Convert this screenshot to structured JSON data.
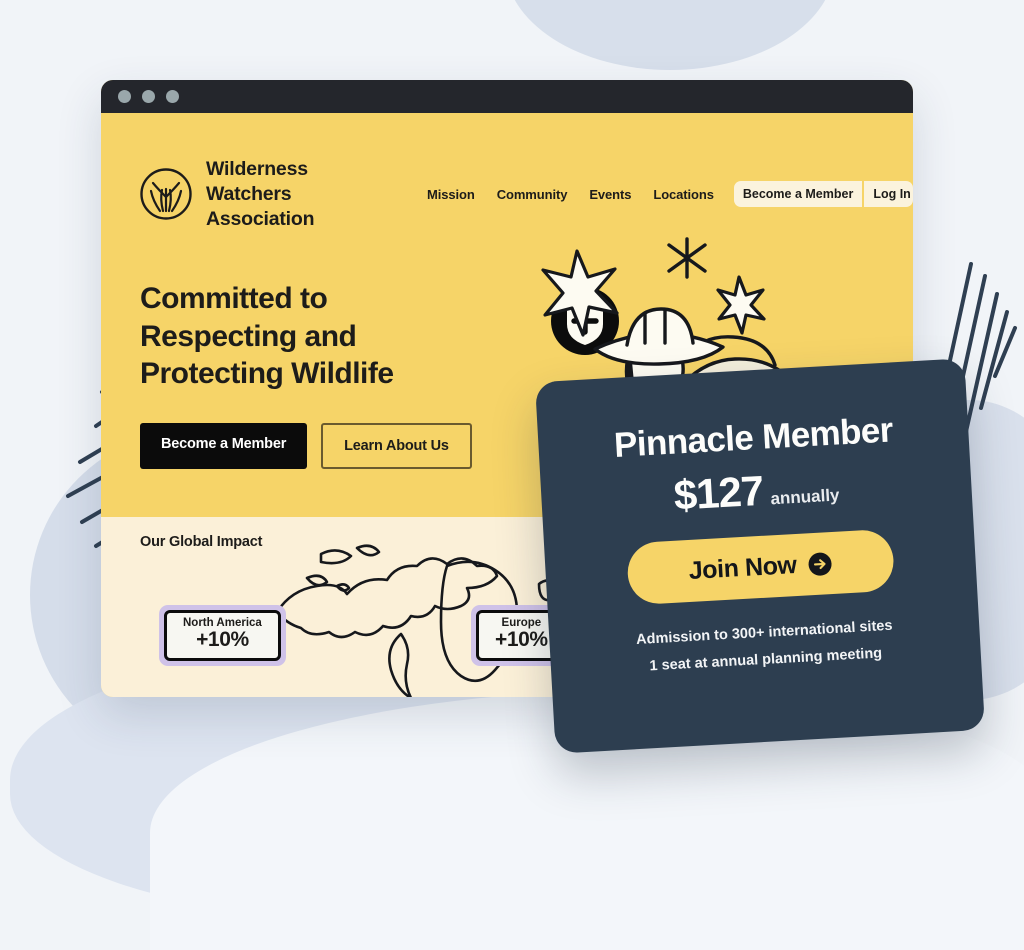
{
  "page": {
    "background_color": "#f1f4f8",
    "blob_color": "#d7dfeb"
  },
  "browser": {
    "titlebar_color": "#24262c",
    "traffic_lights": [
      "close-dot",
      "minimize-dot",
      "maximize-dot"
    ]
  },
  "site": {
    "hero_bg": "#f6d468",
    "impact_bg": "#fbf0d8",
    "brand": {
      "logo_icon": "grass-circle-logo-icon",
      "name": "Wilderness Watchers\nAssociation"
    },
    "nav": {
      "links": [
        {
          "label": "Mission"
        },
        {
          "label": "Community"
        },
        {
          "label": "Events"
        },
        {
          "label": "Locations"
        }
      ],
      "become_member": "Become a Member",
      "log_in": "Log In"
    },
    "hero": {
      "headline": "Committed to\nRespecting and\nProtecting Wildlife",
      "primary_cta": "Become a Member",
      "secondary_cta": "Learn About Us",
      "illustration": "hiker-with-hat-and-rocks-illustration",
      "decor_icons": [
        "star-icon",
        "sparkle-icon",
        "four-point-sparkle-icon",
        "shield-plus-badge-icon"
      ]
    },
    "impact": {
      "title": "Our Global Impact",
      "map_icon": "world-map-outline",
      "badges": [
        {
          "region": "North America",
          "value": "+10%"
        },
        {
          "region": "Europe",
          "value": "+10%"
        }
      ]
    }
  },
  "pricing_card": {
    "background_color": "#2d3e50",
    "accent_color": "#f6d468",
    "title": "Pinnacle Member",
    "price": "$127",
    "period": "annually",
    "join_label": "Join Now",
    "join_icon": "arrow-right-circle-icon",
    "features": [
      "Admission to 300+ international sites",
      "1 seat at annual planning meeting"
    ]
  }
}
